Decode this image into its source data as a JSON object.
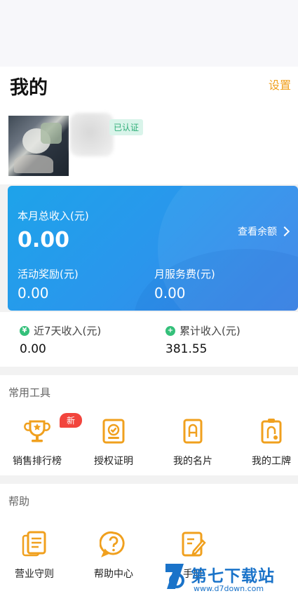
{
  "header": {
    "title": "我的",
    "settings_label": "设置"
  },
  "profile": {
    "verified_label": "已认证"
  },
  "income_card": {
    "month_income_label": "本月总收入(元)",
    "month_income_value": "0.00",
    "view_balance_label": "查看余额",
    "reward_label": "活动奖励(元)",
    "reward_value": "0.00",
    "fee_label": "月服务费(元)",
    "fee_value": "0.00"
  },
  "stats": [
    {
      "label": "近7天收入(元)",
      "value": "0.00",
      "icon": "yen-icon"
    },
    {
      "label": "累计收入(元)",
      "value": "381.55",
      "icon": "plus-icon"
    }
  ],
  "tools": {
    "title": "常用工具",
    "new_badge": "新",
    "items": [
      {
        "label": "销售排行榜",
        "icon": "trophy-icon"
      },
      {
        "label": "授权证明",
        "icon": "certificate-icon"
      },
      {
        "label": "我的名片",
        "icon": "name-card-icon"
      },
      {
        "label": "我的工牌",
        "icon": "badge-icon"
      }
    ]
  },
  "help": {
    "title": "帮助",
    "items": [
      {
        "label": "营业守则",
        "icon": "rules-icon"
      },
      {
        "label": "帮助中心",
        "icon": "help-icon"
      },
      {
        "label": "手册",
        "icon": "manual-icon"
      }
    ]
  },
  "watermark": {
    "text": "第七下载站",
    "sub": "www.d7down.com"
  },
  "colors": {
    "accent": "#f0a01e",
    "card_start": "#1ea3ea",
    "card_end": "#3b83e8",
    "icon": "#f0a01e",
    "badge": "#f2453d",
    "green": "#34c07a"
  }
}
